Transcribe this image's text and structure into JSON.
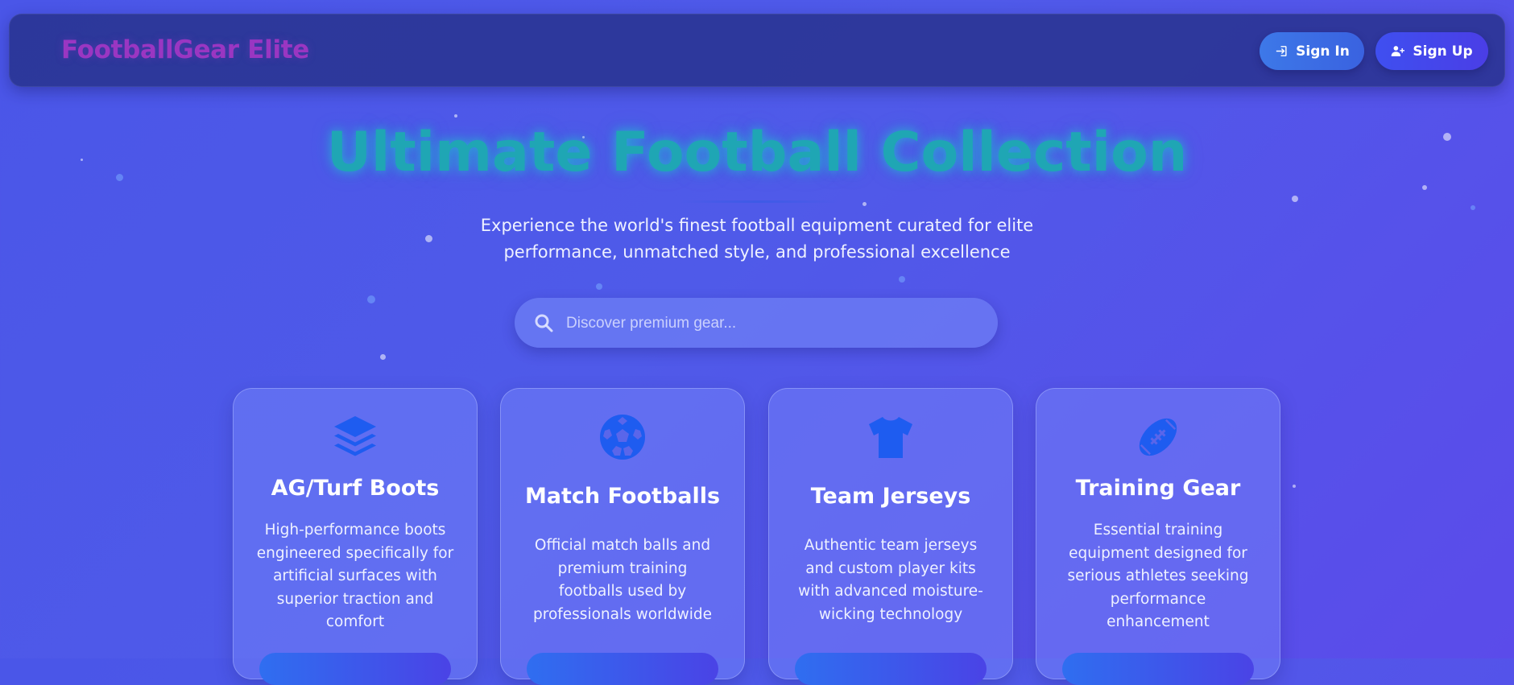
{
  "header": {
    "brand": "FootballGear Elite",
    "sign_in_label": "Sign In",
    "sign_in_icon": "sign-in-icon",
    "sign_up_label": "Sign Up",
    "sign_up_icon": "user-plus-icon"
  },
  "hero": {
    "title": "Ultimate Football Collection",
    "subtitle": "Experience the world's finest football equipment curated for elite performance, unmatched style, and professional excellence"
  },
  "search": {
    "placeholder": "Discover premium gear...",
    "value": ""
  },
  "cards": [
    {
      "icon": "layers-icon",
      "title": "AG/Turf Boots",
      "description": "High-performance boots engineered specifically for artificial surfaces with superior traction and comfort"
    },
    {
      "icon": "football-icon",
      "title": "Match Footballs",
      "description": "Official match balls and premium training footballs used by professionals worldwide"
    },
    {
      "icon": "tshirt-icon",
      "title": "Team Jerseys",
      "description": "Authentic team jerseys and custom player kits with advanced moisture-wicking technology"
    },
    {
      "icon": "american-football-icon",
      "title": "Training Gear",
      "description": "Essential training equipment designed for serious athletes seeking performance enhancement"
    }
  ],
  "colors": {
    "brand": "#9a36c2",
    "title": "#1fa6b4",
    "accent_blue": "#3a62e0",
    "icon_blue": "#1e5cf0"
  }
}
